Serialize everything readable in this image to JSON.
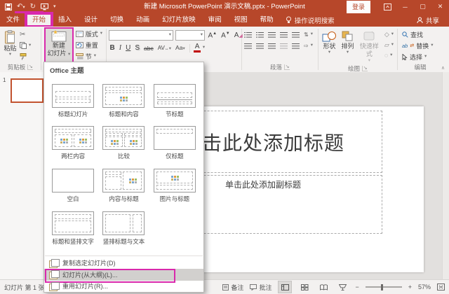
{
  "colors": {
    "theme_red": "#b7472a",
    "annotation_magenta": "#d929ac",
    "thumbnail_selection": "#c2532f"
  },
  "titlebar": {
    "title": "新建 Microsoft PowerPoint 演示文稿.pptx - PowerPoint",
    "signin_label": "登录"
  },
  "menubar": {
    "tabs": [
      "文件",
      "开始",
      "插入",
      "设计",
      "切换",
      "动画",
      "幻灯片放映",
      "审阅",
      "视图",
      "帮助"
    ],
    "tellme_label": "操作说明搜索",
    "share_label": "共享"
  },
  "ribbon": {
    "clipboard": {
      "paste_label": "粘贴",
      "group_label": "剪贴板"
    },
    "slides": {
      "new_slide_line1": "新建",
      "new_slide_line2": "幻灯片",
      "layout_label": "版式",
      "reset_label": "重置",
      "section_label": "节"
    },
    "font": {
      "bold": "B",
      "italic": "I",
      "underline": "U",
      "shadow": "S",
      "strike": "abc",
      "spacing": "AV",
      "case": "Aa",
      "color": "A"
    },
    "paragraph": {
      "group_label": "段落"
    },
    "drawing": {
      "shapes_label": "形状",
      "arrange_label": "排列",
      "quickstyles_label": "快速样式",
      "group_label": "绘图"
    },
    "editing": {
      "find_label": "查找",
      "replace_label": "替换",
      "select_label": "选择",
      "group_label": "编辑"
    }
  },
  "dropdown": {
    "header": "Office 主题",
    "layouts": [
      {
        "label": "标题幻灯片"
      },
      {
        "label": "标题和内容"
      },
      {
        "label": "节标题"
      },
      {
        "label": "两栏内容"
      },
      {
        "label": "比较"
      },
      {
        "label": "仅标题"
      },
      {
        "label": "空白"
      },
      {
        "label": "内容与标题"
      },
      {
        "label": "图片与标题"
      },
      {
        "label": "标题和竖排文字"
      },
      {
        "label": "竖排标题与文本"
      }
    ],
    "menu_items": [
      {
        "label": "复制选定幻灯片(D)"
      },
      {
        "label": "幻灯片(从大纲)(L)..."
      },
      {
        "label": "重用幻灯片(R)..."
      }
    ]
  },
  "thumbnail_panel": {
    "slide_number": "1"
  },
  "slide": {
    "title_placeholder": "单击此处添加标题",
    "subtitle_placeholder": "单击此处添加副标题"
  },
  "statusbar": {
    "slide_info": "幻灯片 第 1 张, 共",
    "notes_label": "备注",
    "comments_label": "批注",
    "zoom_level": "57%"
  }
}
